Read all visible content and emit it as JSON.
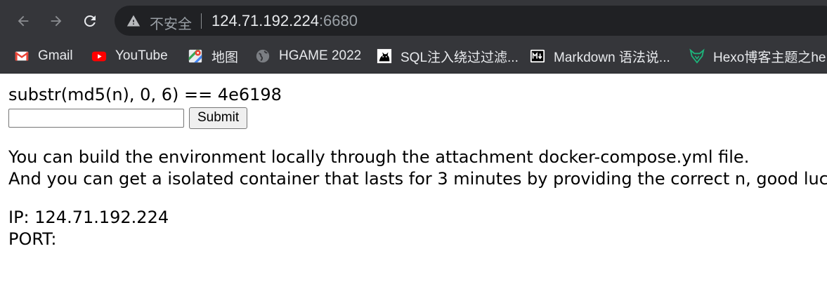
{
  "browser": {
    "security_label": "不安全",
    "url_host": "124.71.192.224",
    "url_port": ":6680",
    "icons": {
      "back": "back-arrow-icon",
      "forward": "forward-arrow-icon",
      "reload": "reload-icon",
      "security": "warning-triangle-icon"
    }
  },
  "bookmarks": [
    {
      "label": "Gmail",
      "icon": "gmail-icon"
    },
    {
      "label": "YouTube",
      "icon": "youtube-icon"
    },
    {
      "label": "地图",
      "icon": "maps-icon"
    },
    {
      "label": "HGAME 2022",
      "icon": "globe-icon"
    },
    {
      "label": "SQL注入绕过过滤...",
      "icon": "cat-icon"
    },
    {
      "label": "Markdown 语法说...",
      "icon": "markdown-icon"
    },
    {
      "label": "Hexo博客主题之he...",
      "icon": "fox-icon"
    }
  ],
  "page": {
    "challenge": "substr(md5(n), 0, 6) == 4e6198",
    "input_value": "",
    "submit_label": "Submit",
    "info_line_1": "You can build the environment locally through the attachment docker-compose.yml file.",
    "info_line_2": "And you can get a isolated container that lasts for 3 minutes by providing the correct n, good luck!",
    "ip_line": "IP: 124.71.192.224",
    "port_line": "PORT:"
  }
}
